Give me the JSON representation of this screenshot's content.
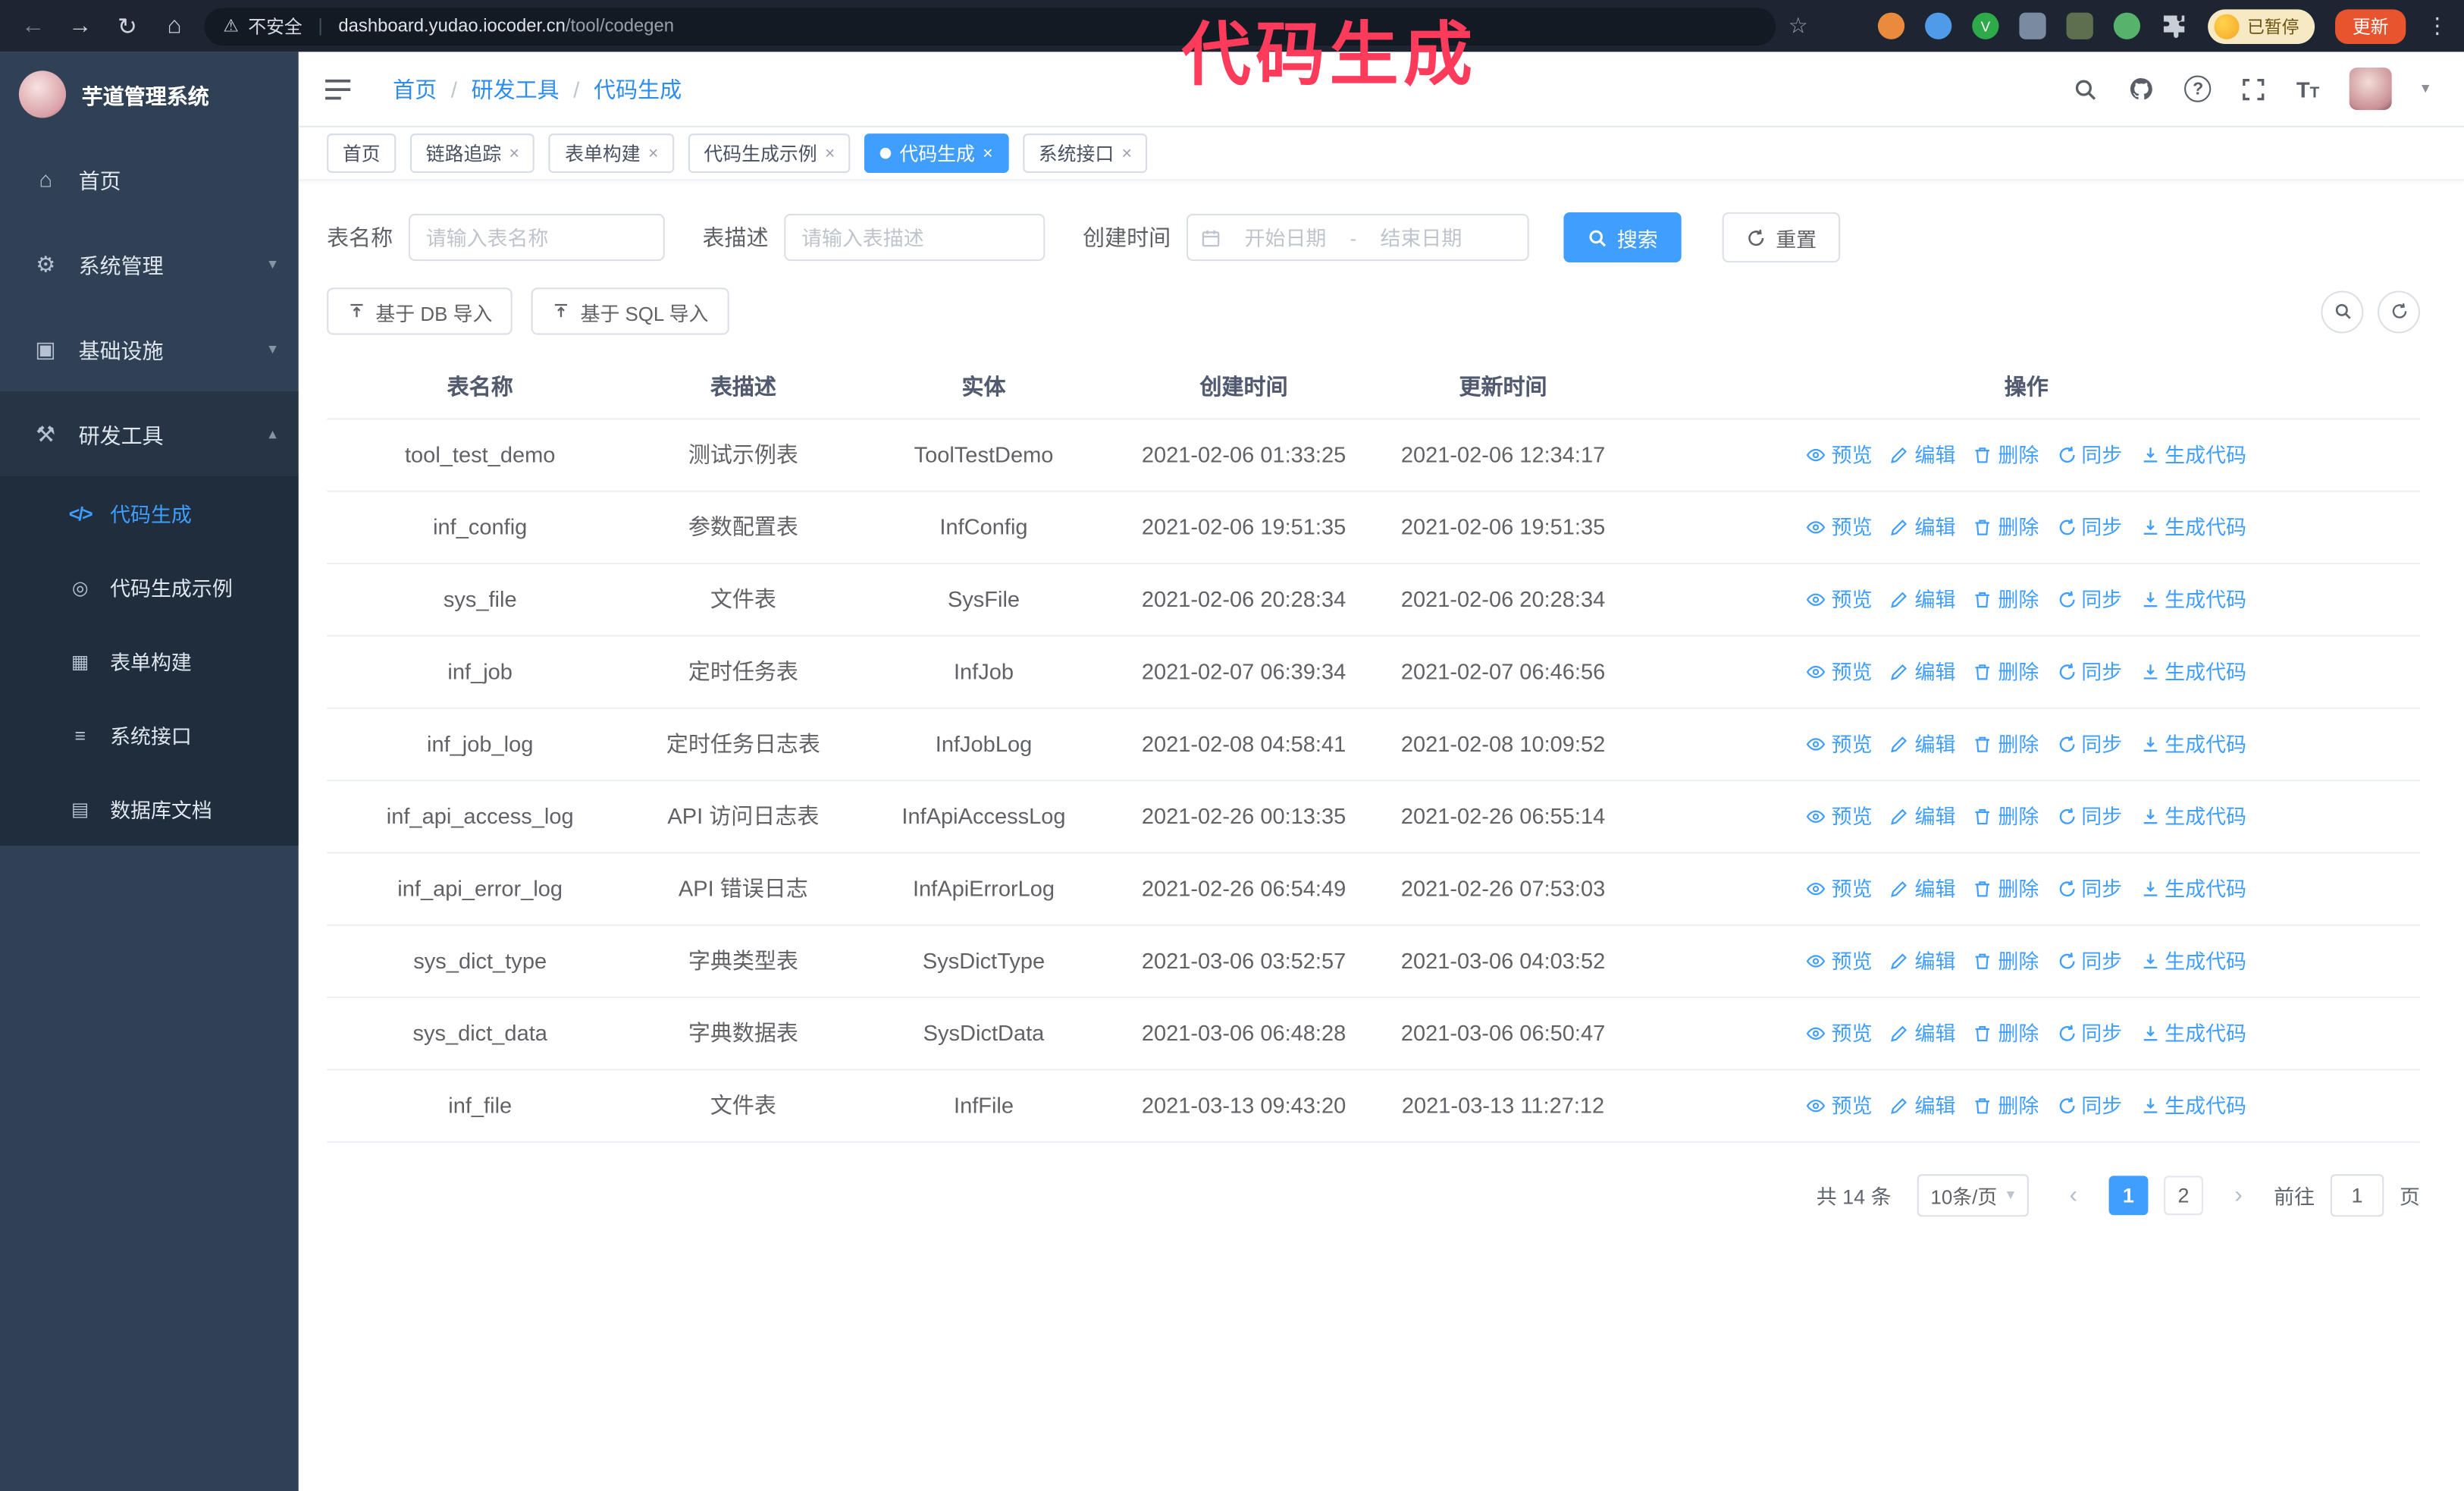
{
  "browser": {
    "security_label": "不安全",
    "domain": "dashboard.yudao.iocoder.cn",
    "path": "/tool/codegen",
    "paused_badge": "已暂停",
    "update_button": "更新"
  },
  "annotation": {
    "text": "代码生成",
    "color": "#ff3b5c"
  },
  "sidebar": {
    "title": "芋道管理系统",
    "items": [
      {
        "label": "首页",
        "icon": "home-icon"
      },
      {
        "label": "系统管理",
        "icon": "gear-icon",
        "expandable": true
      },
      {
        "label": "基础设施",
        "icon": "infrastructure-icon",
        "expandable": true
      },
      {
        "label": "研发工具",
        "icon": "tools-icon",
        "expandable": true,
        "expanded": true
      }
    ],
    "subitems": [
      {
        "label": "代码生成",
        "icon": "code-icon",
        "active": true
      },
      {
        "label": "代码生成示例",
        "icon": "example-icon"
      },
      {
        "label": "表单构建",
        "icon": "form-builder-icon"
      },
      {
        "label": "系统接口",
        "icon": "api-icon"
      },
      {
        "label": "数据库文档",
        "icon": "database-doc-icon"
      }
    ]
  },
  "header": {
    "breadcrumb": [
      "首页",
      "研发工具",
      "代码生成"
    ],
    "icons": [
      "search-icon",
      "github-icon",
      "help-icon",
      "fullscreen-icon",
      "font-size-icon",
      "avatar",
      "chevron-down-icon"
    ]
  },
  "tabs": [
    {
      "label": "首页",
      "closable": false,
      "active": false
    },
    {
      "label": "链路追踪",
      "closable": true,
      "active": false
    },
    {
      "label": "表单构建",
      "closable": true,
      "active": false
    },
    {
      "label": "代码生成示例",
      "closable": true,
      "active": false
    },
    {
      "label": "代码生成",
      "closable": true,
      "active": true
    },
    {
      "label": "系统接口",
      "closable": true,
      "active": false
    }
  ],
  "filters": {
    "table_name": {
      "label": "表名称",
      "placeholder": "请输入表名称",
      "value": ""
    },
    "table_desc": {
      "label": "表描述",
      "placeholder": "请输入表描述",
      "value": ""
    },
    "create_time": {
      "label": "创建时间",
      "start_placeholder": "开始日期",
      "separator": "-",
      "end_placeholder": "结束日期"
    },
    "search_button": "搜索",
    "reset_button": "重置"
  },
  "toolbar": {
    "import_db": "基于 DB 导入",
    "import_sql": "基于 SQL 导入"
  },
  "table": {
    "columns": [
      "表名称",
      "表描述",
      "实体",
      "创建时间",
      "更新时间",
      "操作"
    ],
    "actions": [
      {
        "label": "预览",
        "icon": "eye-icon"
      },
      {
        "label": "编辑",
        "icon": "edit-pencil-icon"
      },
      {
        "label": "删除",
        "icon": "delete-trash-icon"
      },
      {
        "label": "同步",
        "icon": "sync-icon"
      },
      {
        "label": "生成代码",
        "icon": "download-code-icon"
      }
    ],
    "rows": [
      {
        "name": "tool_test_demo",
        "desc": "测试示例表",
        "entity": "ToolTestDemo",
        "created": "2021-02-06 01:33:25",
        "updated": "2021-02-06 12:34:17"
      },
      {
        "name": "inf_config",
        "desc": "参数配置表",
        "entity": "InfConfig",
        "created": "2021-02-06 19:51:35",
        "updated": "2021-02-06 19:51:35"
      },
      {
        "name": "sys_file",
        "desc": "文件表",
        "entity": "SysFile",
        "created": "2021-02-06 20:28:34",
        "updated": "2021-02-06 20:28:34"
      },
      {
        "name": "inf_job",
        "desc": "定时任务表",
        "entity": "InfJob",
        "created": "2021-02-07 06:39:34",
        "updated": "2021-02-07 06:46:56"
      },
      {
        "name": "inf_job_log",
        "desc": "定时任务日志表",
        "entity": "InfJobLog",
        "created": "2021-02-08 04:58:41",
        "updated": "2021-02-08 10:09:52"
      },
      {
        "name": "inf_api_access_log",
        "desc": "API 访问日志表",
        "entity": "InfApiAccessLog",
        "created": "2021-02-26 00:13:35",
        "updated": "2021-02-26 06:55:14"
      },
      {
        "name": "inf_api_error_log",
        "desc": "API 错误日志",
        "entity": "InfApiErrorLog",
        "created": "2021-02-26 06:54:49",
        "updated": "2021-02-26 07:53:03"
      },
      {
        "name": "sys_dict_type",
        "desc": "字典类型表",
        "entity": "SysDictType",
        "created": "2021-03-06 03:52:57",
        "updated": "2021-03-06 04:03:52"
      },
      {
        "name": "sys_dict_data",
        "desc": "字典数据表",
        "entity": "SysDictData",
        "created": "2021-03-06 06:48:28",
        "updated": "2021-03-06 06:50:47"
      },
      {
        "name": "inf_file",
        "desc": "文件表",
        "entity": "InfFile",
        "created": "2021-03-13 09:43:20",
        "updated": "2021-03-13 11:27:12"
      }
    ]
  },
  "pagination": {
    "total": "共 14 条",
    "page_size": "10条/页",
    "pages": [
      "1",
      "2"
    ],
    "active_page": "1",
    "goto_label": "前往",
    "goto_value": "1",
    "goto_unit": "页"
  },
  "colors": {
    "primary": "#409eff",
    "sidebar_bg": "#304156",
    "submenu_bg": "#1f2d3d",
    "annotation": "#ff3b5c",
    "chrome_bg": "#1c2531"
  }
}
